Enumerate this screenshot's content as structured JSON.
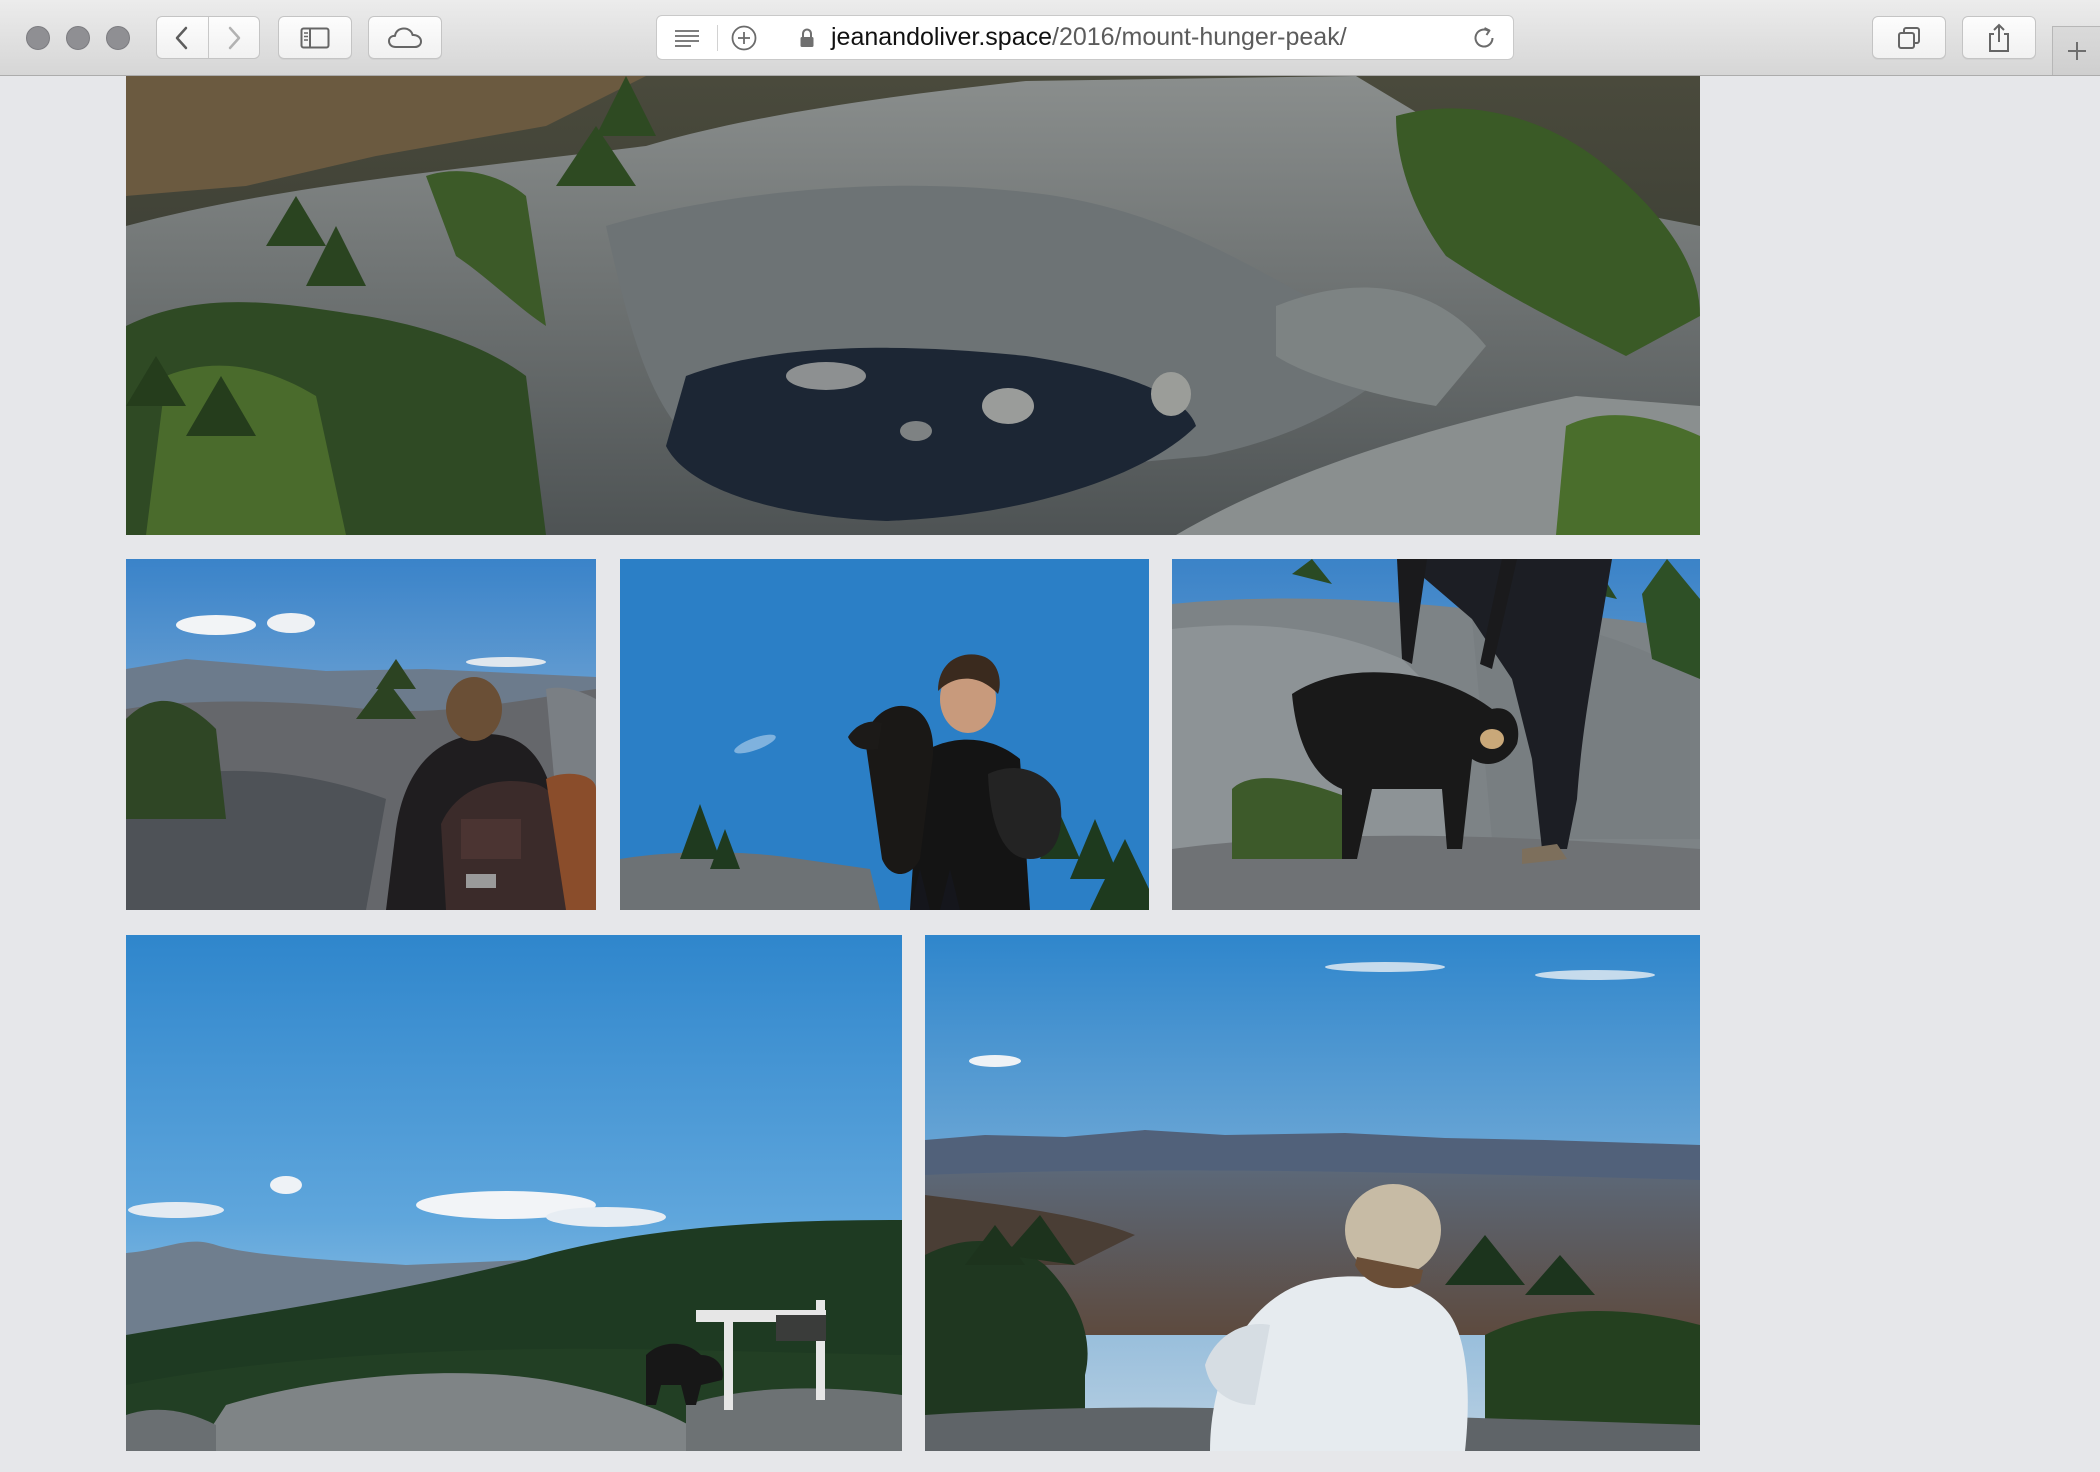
{
  "browser": {
    "url_host": "jeanandoliver.space",
    "url_path": "/2016/mount-hunger-peak/"
  },
  "toolbar": {
    "icons": [
      "close-icon",
      "minimize-icon",
      "zoom-icon",
      "back-icon",
      "forward-icon",
      "sidebar-icon",
      "icloud-icon",
      "reader-icon",
      "add-icon",
      "lock-icon",
      "reload-icon",
      "tabs-overview-icon",
      "share-icon",
      "new-tab-icon"
    ]
  },
  "gallery": {
    "photos": [
      {
        "name": "photo-rocky-pool"
      },
      {
        "name": "photo-hiker-backpack-view"
      },
      {
        "name": "photo-person-holding-dog"
      },
      {
        "name": "photo-petting-dog-on-rock"
      },
      {
        "name": "photo-dog-at-summit-sign"
      },
      {
        "name": "photo-person-in-beanie-view"
      }
    ]
  },
  "colors": {
    "page_background": "#e6e7ea",
    "sky_blue": "#2c86cc",
    "rock_gray": "#6c7073",
    "forest_green": "#2c4a22"
  }
}
